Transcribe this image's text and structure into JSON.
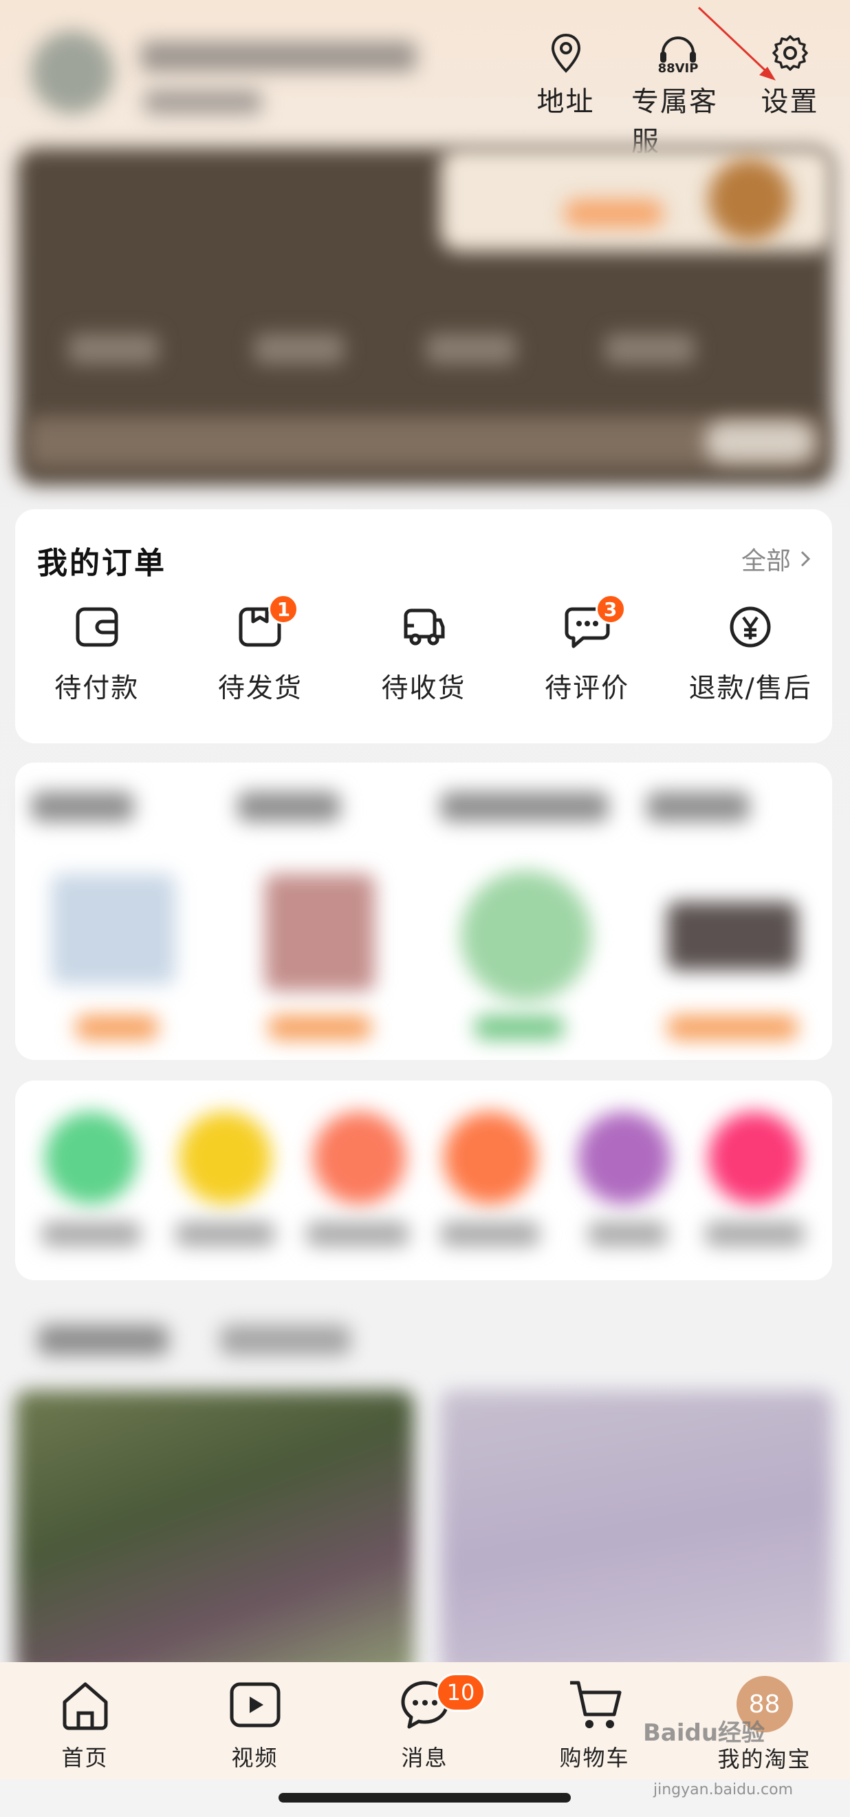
{
  "header": {
    "actions": [
      {
        "label": "地址",
        "icon": "location-pin-icon"
      },
      {
        "label": "专属客服",
        "icon": "headset-88vip-icon",
        "icon_text": "88VIP"
      },
      {
        "label": "设置",
        "icon": "gear-icon"
      }
    ]
  },
  "orders": {
    "title": "我的订单",
    "all_label": "全部",
    "items": [
      {
        "label": "待付款",
        "icon": "wallet-icon",
        "badge": null
      },
      {
        "label": "待发货",
        "icon": "package-icon",
        "badge": "1"
      },
      {
        "label": "待收货",
        "icon": "truck-icon",
        "badge": null
      },
      {
        "label": "待评价",
        "icon": "chat-bubble-icon",
        "badge": "3"
      },
      {
        "label": "退款/售后",
        "icon": "yen-circle-icon",
        "badge": null
      }
    ]
  },
  "tabbar": {
    "items": [
      {
        "label": "首页",
        "icon": "home-icon"
      },
      {
        "label": "视频",
        "icon": "video-play-icon"
      },
      {
        "label": "消息",
        "icon": "message-icon",
        "badge": "10"
      },
      {
        "label": "购物车",
        "icon": "cart-icon"
      },
      {
        "label": "我的淘宝",
        "icon": "avatar-88-icon",
        "avatar_text": "88"
      }
    ]
  },
  "watermark": {
    "text": "Baidu经验",
    "sub": "jingyan.baidu.com"
  },
  "colors": {
    "badge": "#ff5a12",
    "annotation_arrow": "#e0352b"
  }
}
